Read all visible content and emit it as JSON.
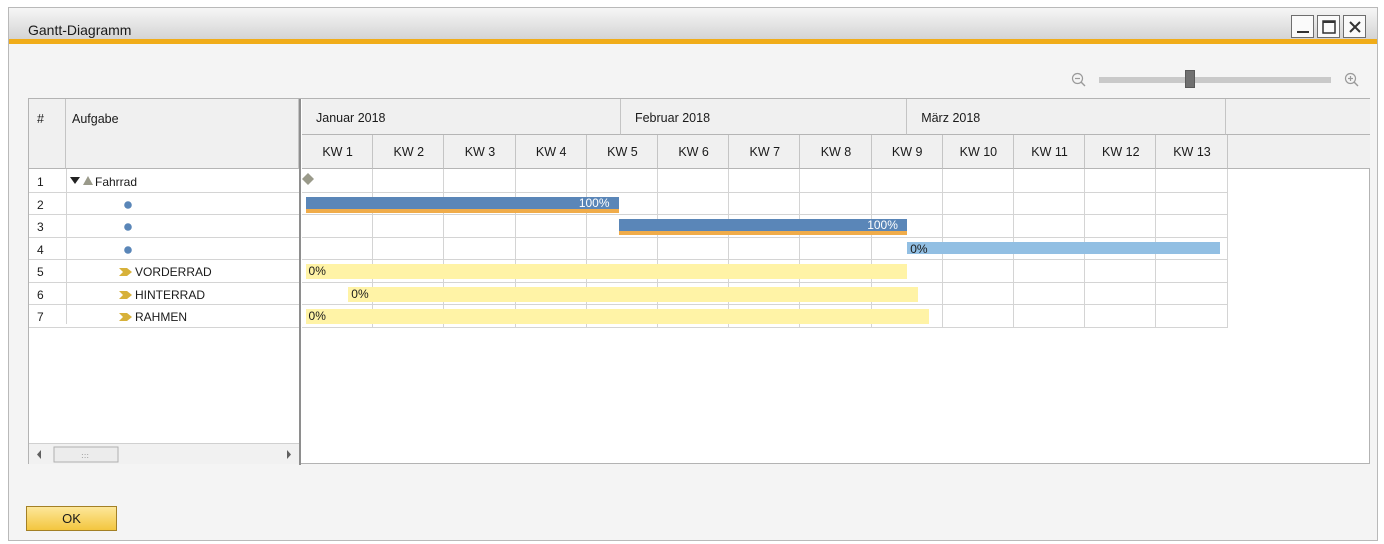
{
  "window": {
    "title": "Gantt-Diagramm"
  },
  "columns": {
    "number": "#",
    "task": "Aufgabe"
  },
  "months": [
    "Januar 2018",
    "Februar 2018",
    "März 2018"
  ],
  "weeks": [
    "KW 1",
    "KW 2",
    "KW 3",
    "KW 4",
    "KW 5",
    "KW 6",
    "KW 7",
    "KW 8",
    "KW 9",
    "KW 10",
    "KW 11",
    "KW 12",
    "KW 13"
  ],
  "rows": [
    {
      "num": "1",
      "label": "Fahrrad",
      "icon": "project-triangle-icon"
    },
    {
      "num": "2",
      "label": "",
      "icon": "task-dot-icon"
    },
    {
      "num": "3",
      "label": "",
      "icon": "task-dot-icon"
    },
    {
      "num": "4",
      "label": "",
      "icon": "task-dot-icon"
    },
    {
      "num": "5",
      "label": "VORDERRAD",
      "icon": "subproject-arrow-icon"
    },
    {
      "num": "6",
      "label": "HINTERRAD",
      "icon": "subproject-arrow-icon"
    },
    {
      "num": "7",
      "label": "RAHMEN",
      "icon": "subproject-arrow-icon"
    }
  ],
  "bars": [
    {
      "row": 2,
      "progress_label": "100%",
      "progress": 1.0,
      "start_week": 0.05,
      "end_week": 4.45,
      "color": "#5a86b8",
      "underline": "#f0ac4a"
    },
    {
      "row": 3,
      "progress_label": "100%",
      "progress": 1.0,
      "start_week": 4.45,
      "end_week": 8.5,
      "color": "#5a86b8",
      "underline": "#f0ac4a"
    },
    {
      "row": 4,
      "progress_label": "0%",
      "progress": 0.0,
      "start_week": 8.5,
      "end_week": 12.9,
      "color": "#92bfe3"
    },
    {
      "row": 5,
      "progress_label": "0%",
      "progress": 0.0,
      "start_week": 0.05,
      "end_week": 8.5,
      "color": "#fff3a6"
    },
    {
      "row": 6,
      "progress_label": "0%",
      "progress": 0.0,
      "start_week": 0.65,
      "end_week": 8.65,
      "color": "#fff3a6"
    },
    {
      "row": 7,
      "progress_label": "0%",
      "progress": 0.0,
      "start_week": 0.05,
      "end_week": 8.8,
      "color": "#fff3a6"
    }
  ],
  "milestone": {
    "row": 1,
    "week": 0.05,
    "color": "#9a9a8a"
  },
  "buttons": {
    "ok": "OK"
  },
  "icons": {
    "zoom_out": "zoom-out-icon",
    "zoom_in": "zoom-in-icon",
    "minimize": "minimize-icon",
    "maximize": "maximize-icon",
    "close": "close-icon"
  },
  "zoom": {
    "level": 0.4
  }
}
